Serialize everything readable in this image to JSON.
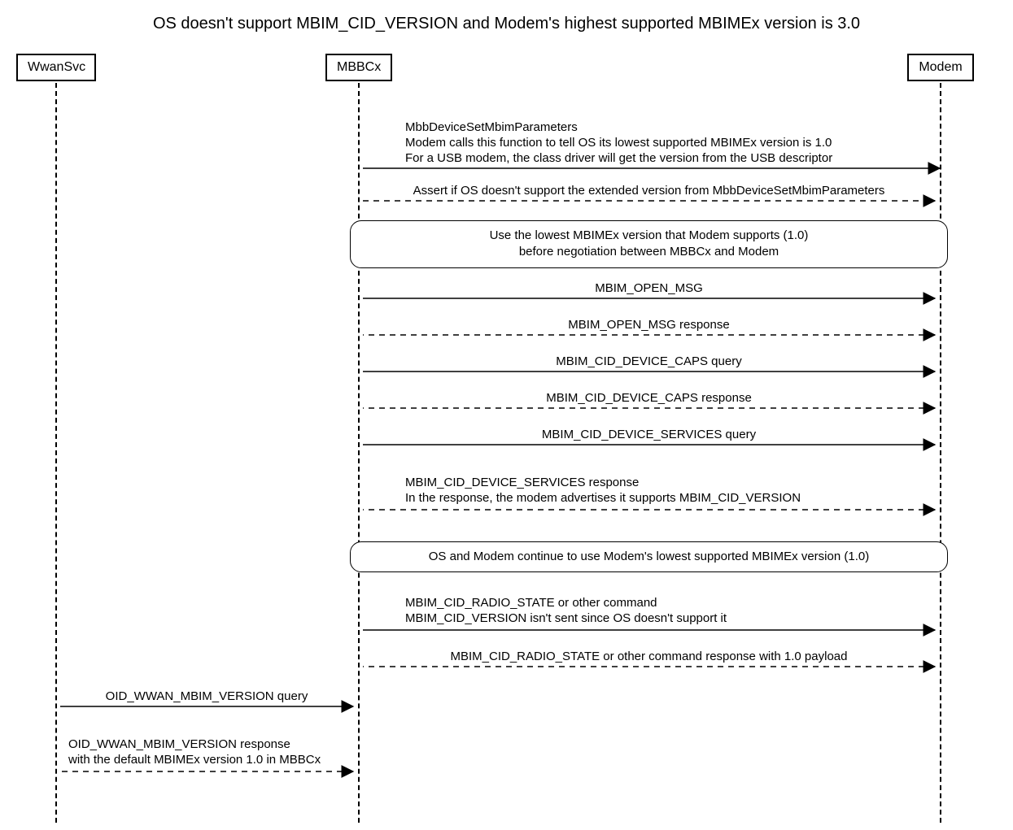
{
  "title": "OS doesn't support MBIM_CID_VERSION and Modem's highest supported MBIMEx version is 3.0",
  "actors": {
    "wwansvc": "WwanSvc",
    "mbbcx": "MBBCx",
    "modem": "Modem"
  },
  "msgs": {
    "m1a": "MbbDeviceSetMbimParameters",
    "m1b": "Modem calls this function to tell OS its lowest supported MBIMEx version is 1.0",
    "m1c": "For a USB modem, the class driver will get the version from the USB descriptor",
    "m2": "Assert if OS doesn't support the extended version from MbbDeviceSetMbimParameters",
    "note1a": "Use the lowest MBIMEx version that Modem supports (1.0)",
    "note1b": "before negotiation between MBBCx and Modem",
    "m3": "MBIM_OPEN_MSG",
    "m4": "MBIM_OPEN_MSG response",
    "m5": "MBIM_CID_DEVICE_CAPS query",
    "m6": "MBIM_CID_DEVICE_CAPS response",
    "m7": "MBIM_CID_DEVICE_SERVICES query",
    "m8a": "MBIM_CID_DEVICE_SERVICES response",
    "m8b": "In the response, the modem advertises it supports MBIM_CID_VERSION",
    "note2": "OS and Modem continue to use Modem's lowest supported MBIMEx version (1.0)",
    "m9a": "MBIM_CID_RADIO_STATE or other command",
    "m9b": "MBIM_CID_VERSION isn't sent since OS doesn't support it",
    "m10": "MBIM_CID_RADIO_STATE or other command response with 1.0 payload",
    "m11": "OID_WWAN_MBIM_VERSION query",
    "m12a": "OID_WWAN_MBIM_VERSION response",
    "m12b": "with the default MBIMEx version 1.0 in MBBCx"
  }
}
